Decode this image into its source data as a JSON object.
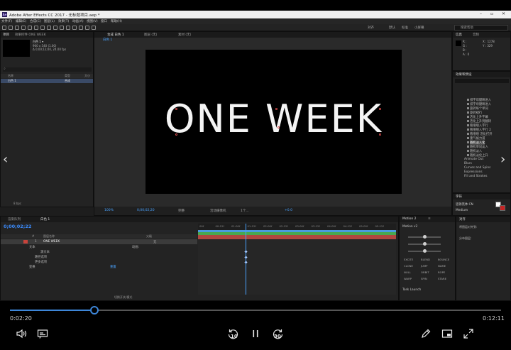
{
  "window": {
    "title": "Adobe After Effects CC 2017 - 无标题项目.aep *",
    "app_badge": "Ae"
  },
  "menu": [
    "文件(F)",
    "编辑(E)",
    "合成(C)",
    "图层(L)",
    "效果(T)",
    "动画(A)",
    "视图(V)",
    "窗口",
    "帮助(H)"
  ],
  "toolbar": {
    "workspaces": [
      "对齐",
      "默认",
      "标准",
      "小屏幕"
    ],
    "search_placeholder": "搜索帮助"
  },
  "project": {
    "tabs": [
      "项目",
      "效果控件 ONE WEEK"
    ],
    "item_name": "白色 1 ▾",
    "item_info1": "960 x 540 (1.00)",
    "item_info2": "Δ 0;00;12;00, 24.00 fps",
    "search_icon": "search-icon",
    "columns": [
      "名称",
      "类型",
      "大小"
    ],
    "row": {
      "name": "白色 1",
      "type": "合成"
    },
    "footer": "8 bpc"
  },
  "viewer": {
    "tabs": [
      "合成 白色 1",
      "图层 (无)",
      "素材 (无)"
    ],
    "breadcrumb": "白色 1",
    "canvas_text": "ONE WEEK",
    "zoom": "100%",
    "timecode": "0;00;02;20",
    "quality": "完整",
    "camera": "活动摄像机",
    "views": "1个...",
    "exposure": "+0.0"
  },
  "info_panel": {
    "tabs": [
      "信息",
      "音频"
    ],
    "r": "R :",
    "g": "G :",
    "b": "B :",
    "a": "A : 0",
    "x": "X : 1278",
    "y": "Y : 329"
  },
  "effects_panel": {
    "title": "效果和预设",
    "items": [
      "排字母键映进入",
      "排字母键映进入",
      "旋转每个单词",
      "旋转褪行",
      "活化上升字幕",
      "活化上升到翻转",
      "看嗖嗖入字行",
      "看嗖嗖入字行 2",
      "看嗖嗖 活化打开",
      "重气候力道",
      "随机淡入化",
      "随机单词淡入",
      "随机淡入",
      "随机淡化上升"
    ],
    "highlighted_index": 10,
    "folders": [
      "Animate Out",
      "Blurs",
      "Curves and Spins",
      "Expressions",
      "Fill and Strokes"
    ]
  },
  "char_panel": {
    "title": "字符",
    "font": "思源黑体 CN",
    "style": "Medium"
  },
  "timeline": {
    "tabs": [
      "渲染队列",
      "白色 1"
    ],
    "timecode": "0;00;02;22",
    "layer_header": [
      "#",
      "图层名称",
      "父级"
    ],
    "layer": {
      "num": "1",
      "name": "ONE WEEK",
      "parent": "无"
    },
    "props": [
      "文本",
      "源文本",
      "路径选项",
      "更多选项",
      "变换"
    ],
    "animate_label": "动画:",
    "reset_label": "重置",
    "ruler": [
      "00f",
      "00:12f",
      "01:00f",
      "01:12f",
      "02:00f",
      "02:12f",
      "03:00f",
      "03:12f",
      "04:00f",
      "04:12f",
      "05:00f",
      "05:12f"
    ],
    "footer": "切换开关/模式"
  },
  "motion_panel": {
    "tabs": [
      "Motion 2",
      "≡"
    ],
    "preset": "Motion v2",
    "buttons": [
      "EXCITE",
      "BLEND",
      "BOUNCE",
      "CLONE",
      "JUMP",
      "NAME",
      "NULL",
      "ORBIT",
      "ROPE",
      "WARP",
      "SPIN",
      "STARE"
    ],
    "launch": "Task Launch"
  },
  "align_panel": {
    "title": "对齐",
    "rows": [
      "将图层对齐到:",
      "分布图层:"
    ]
  },
  "player": {
    "current": "0:02:20",
    "total": "0:12:11",
    "progress": 0.1716,
    "skip_back": "10",
    "skip_fwd": "30",
    "icons": [
      "volume-icon",
      "subtitles-icon",
      "rewind-10-icon",
      "pause-icon",
      "forward-30-icon",
      "pen-icon",
      "miniplayer-icon",
      "fullscreen-icon"
    ]
  }
}
